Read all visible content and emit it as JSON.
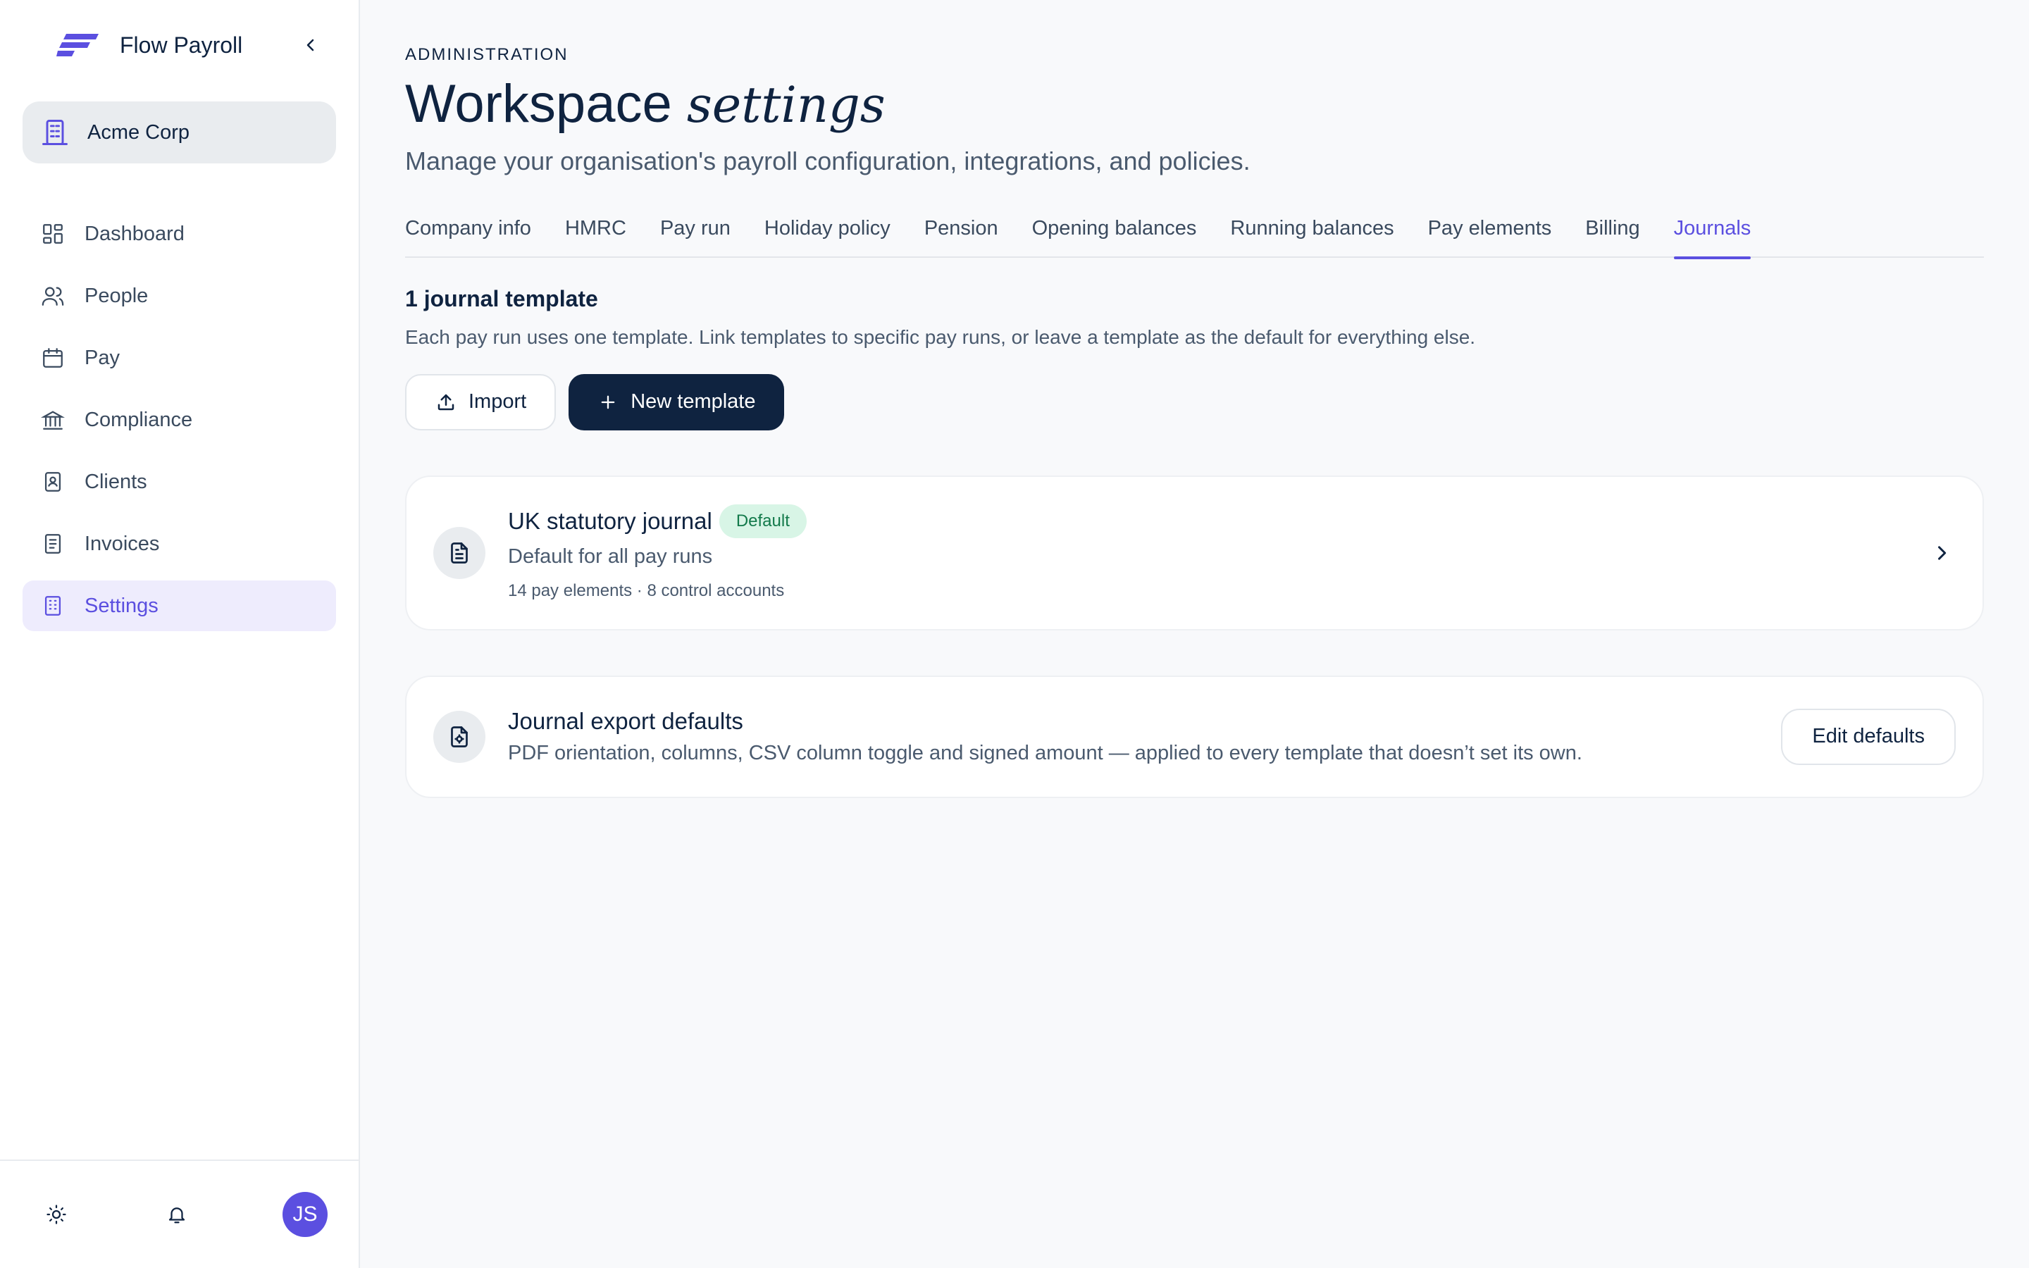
{
  "app": {
    "name": "Flow Payroll",
    "brand_color": "#5b4fe0"
  },
  "org": {
    "name": "Acme Corp"
  },
  "nav": [
    {
      "label": "Dashboard",
      "icon": "dashboard-icon",
      "active": false
    },
    {
      "label": "People",
      "icon": "people-icon",
      "active": false
    },
    {
      "label": "Pay",
      "icon": "calendar-icon",
      "active": false
    },
    {
      "label": "Compliance",
      "icon": "bank-icon",
      "active": false
    },
    {
      "label": "Clients",
      "icon": "contact-card-icon",
      "active": false
    },
    {
      "label": "Invoices",
      "icon": "receipt-icon",
      "active": false
    },
    {
      "label": "Settings",
      "icon": "building-icon",
      "active": true
    }
  ],
  "footer": {
    "avatar_initials": "JS"
  },
  "header": {
    "eyebrow": "ADMINISTRATION",
    "title": "Workspace",
    "title_serif": "settings",
    "subtitle": "Manage your organisation's payroll configuration, integrations, and policies."
  },
  "tabs": [
    {
      "label": "Company info",
      "active": false
    },
    {
      "label": "HMRC",
      "active": false
    },
    {
      "label": "Pay run",
      "active": false
    },
    {
      "label": "Holiday policy",
      "active": false
    },
    {
      "label": "Pension",
      "active": false
    },
    {
      "label": "Opening balances",
      "active": false
    },
    {
      "label": "Running balances",
      "active": false
    },
    {
      "label": "Pay elements",
      "active": false
    },
    {
      "label": "Billing",
      "active": false
    },
    {
      "label": "Journals",
      "active": true
    }
  ],
  "journals": {
    "count_label": "1 journal template",
    "description": "Each pay run uses one template. Link templates to specific pay runs, or leave a template as the default for everything else.",
    "import_label": "Import",
    "new_label": "New template",
    "template": {
      "title": "UK statutory journal",
      "badge": "Default",
      "subtitle": "Default for all pay runs",
      "meta": "14 pay elements · 8 control accounts"
    },
    "export_defaults": {
      "title": "Journal export defaults",
      "description": "PDF orientation, columns, CSV column toggle and signed amount — applied to every template that doesn’t set its own.",
      "edit_label": "Edit defaults"
    }
  }
}
